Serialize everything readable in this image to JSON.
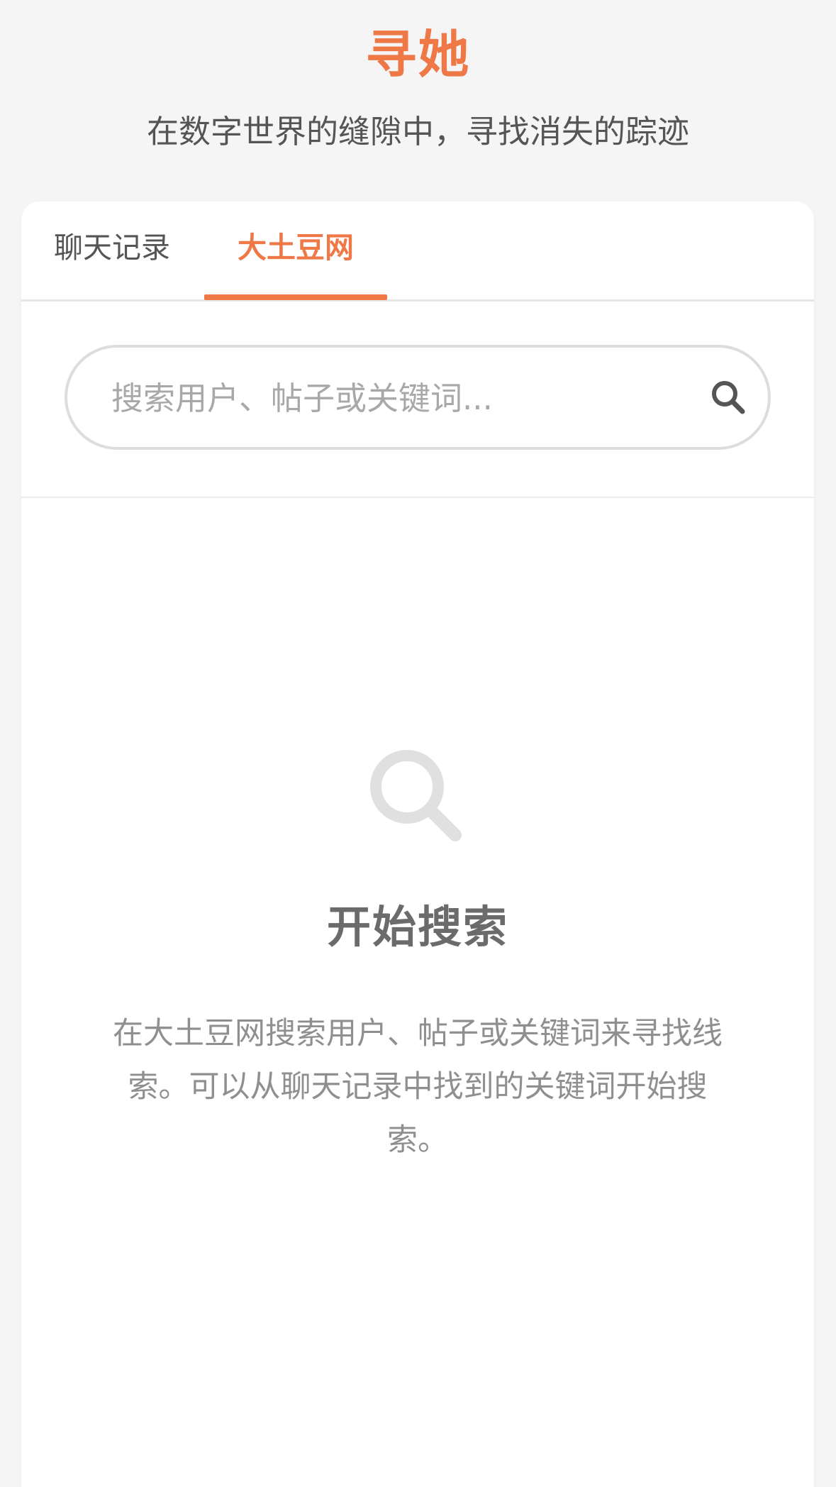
{
  "header": {
    "title": "寻她",
    "subtitle": "在数字世界的缝隙中，寻找消失的踪迹"
  },
  "tabs": [
    {
      "label": "聊天记录",
      "active": false
    },
    {
      "label": "大土豆网",
      "active": true
    }
  ],
  "search": {
    "placeholder": "搜索用户、帖子或关键词...",
    "value": "",
    "button_icon": "search-icon"
  },
  "empty_state": {
    "icon": "search-icon",
    "title": "开始搜索",
    "description": "在大土豆网搜索用户、帖子或关键词来寻找线索。可以从聊天记录中找到的关键词开始搜索。"
  },
  "colors": {
    "accent": "#ee7846",
    "background": "#f5f5f5",
    "card": "#ffffff",
    "text_primary": "#555555",
    "text_muted": "#8f8f8f"
  }
}
